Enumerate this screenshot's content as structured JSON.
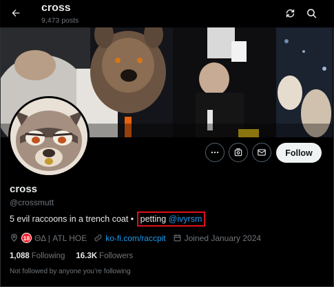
{
  "header": {
    "title": "cross",
    "posts_count": "9,473 posts"
  },
  "actions": {
    "follow_label": "Follow"
  },
  "profile": {
    "display_name": "cross",
    "handle": "@crossmutt",
    "bio_text": "5 evil raccoons in a trench coat • ",
    "bio_highlight_text": "petting ",
    "bio_mention": "@ivyrsm",
    "location": "ΘΔ | ATL HOE",
    "age_badge": "18",
    "website": "ko-fi.com/raccpit",
    "joined": "Joined January 2024",
    "following_count": "1,088",
    "following_label": "Following",
    "followers_count": "16.3K",
    "followers_label": "Followers",
    "followed_by_text": "Not followed by anyone you’re following"
  },
  "colors": {
    "accent": "#1d9bf0",
    "highlight_box": "#e0101a",
    "age_badge": "#f4212e"
  },
  "icons": [
    "back-arrow-icon",
    "refresh-icon",
    "search-icon",
    "more-icon",
    "subscribe-icon",
    "message-icon",
    "location-icon",
    "link-icon",
    "calendar-icon"
  ]
}
